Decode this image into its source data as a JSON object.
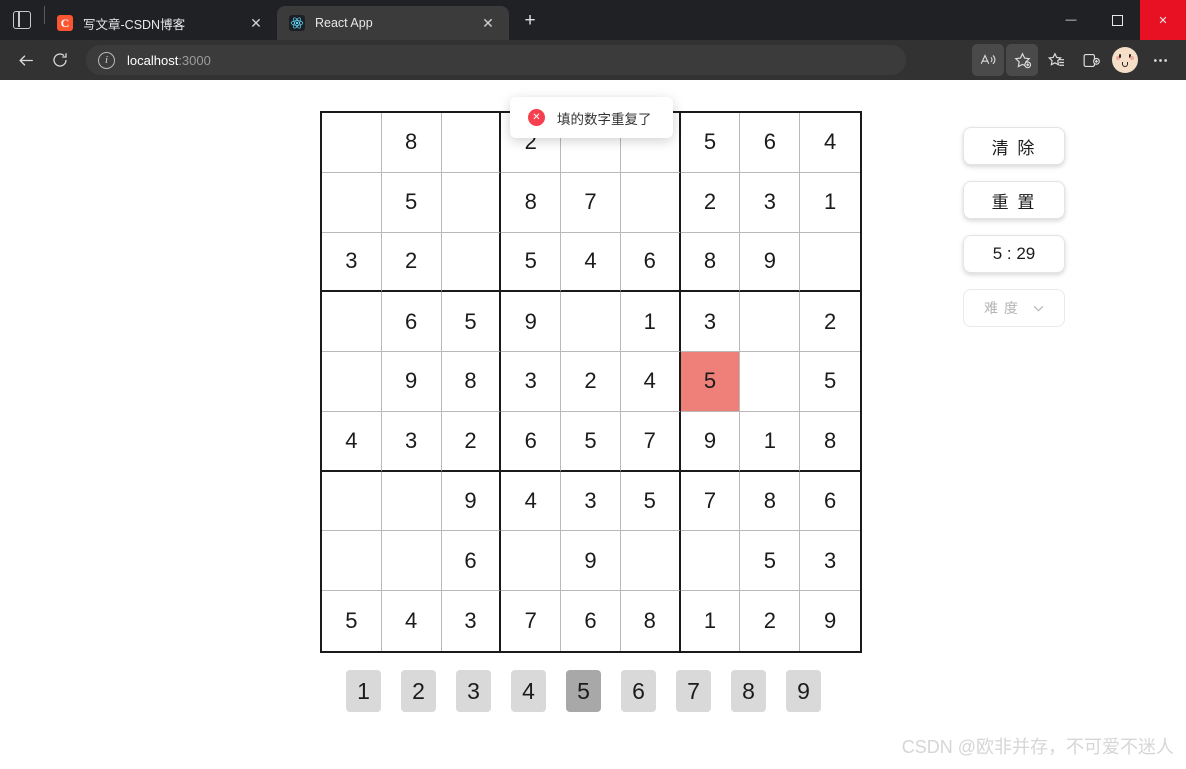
{
  "browser": {
    "tab_list_icon": "tab-list-icon",
    "tabs": [
      {
        "title": "写文章-CSDN博客",
        "favicon_letter": "C",
        "favicon": "csdn-icon",
        "active": false
      },
      {
        "title": "React App",
        "favicon": "react-icon",
        "active": true
      }
    ],
    "new_tab_label": "+",
    "close_label": "✕",
    "window_controls": {
      "minimize": "—",
      "maximize": "▢",
      "close": "✕"
    },
    "nav": {
      "back": "←",
      "reload": "⟳"
    },
    "address": {
      "scheme_icon": "info-icon",
      "host": "localhost",
      "port": ":3000"
    },
    "toolbar_icons": [
      "read-aloud-icon",
      "add-favorite-icon",
      "favorites-icon",
      "collections-icon",
      "profile-avatar",
      "settings-more-icon"
    ]
  },
  "toast": {
    "icon": "error-circle-icon",
    "icon_glyph": "✕",
    "message": "填的数字重复了"
  },
  "controls": {
    "clear_label": "清 除",
    "reset_label": "重 置",
    "timer_label": "5 : 29",
    "difficulty_placeholder": "难 度",
    "chevron": "⌄"
  },
  "numpad": {
    "buttons": [
      "1",
      "2",
      "3",
      "4",
      "5",
      "6",
      "7",
      "8",
      "9"
    ],
    "selected": "5"
  },
  "watermark": "CSDN @欧非并存，不可爱不迷人",
  "colors": {
    "conflict_cell": "#ef8079",
    "toast_icon": "#f6404f",
    "numpad_idle": "#d9d9d9",
    "numpad_selected": "#a8a8a8",
    "grid_thick_line": "#1a1a1a",
    "grid_thin_line": "#b9b9b9"
  },
  "sudoku": {
    "rows": 9,
    "cols": 9,
    "conflict_cell": {
      "row": 5,
      "col": 7
    },
    "grid": [
      [
        "",
        "8",
        "",
        "2",
        "",
        "",
        "5",
        "6",
        "4"
      ],
      [
        "",
        "5",
        "",
        "8",
        "7",
        "",
        "2",
        "3",
        "1"
      ],
      [
        "3",
        "2",
        "",
        "5",
        "4",
        "6",
        "8",
        "9",
        ""
      ],
      [
        "",
        "6",
        "5",
        "9",
        "",
        "1",
        "3",
        "",
        "2"
      ],
      [
        "",
        "9",
        "8",
        "3",
        "2",
        "4",
        "5",
        "",
        "5"
      ],
      [
        "4",
        "3",
        "2",
        "6",
        "5",
        "7",
        "9",
        "1",
        "8"
      ],
      [
        "",
        "",
        "9",
        "4",
        "3",
        "5",
        "7",
        "8",
        "6"
      ],
      [
        "",
        "",
        "6",
        "",
        "9",
        "",
        "",
        "5",
        "3"
      ],
      [
        "5",
        "4",
        "3",
        "7",
        "6",
        "8",
        "1",
        "2",
        "9"
      ]
    ]
  }
}
